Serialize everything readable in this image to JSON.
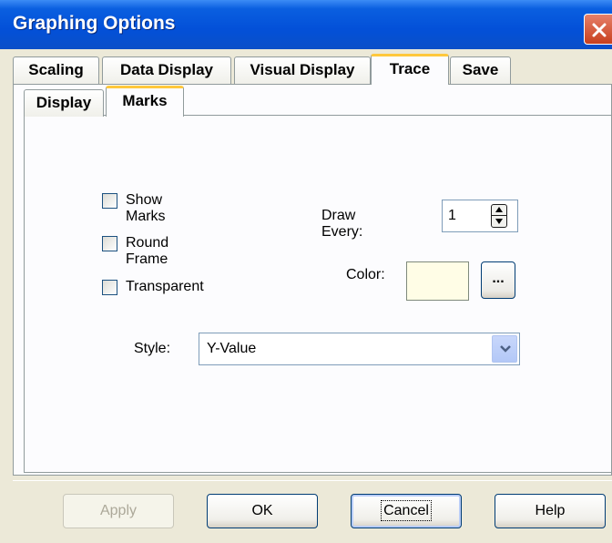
{
  "window": {
    "title": "Graphing Options"
  },
  "tabs": [
    {
      "label": "Scaling",
      "active": false
    },
    {
      "label": "Data Display",
      "active": false
    },
    {
      "label": "Visual Display",
      "active": false
    },
    {
      "label": "Trace",
      "active": true
    },
    {
      "label": "Save",
      "active": false
    }
  ],
  "subtabs": [
    {
      "label": "Display",
      "active": false
    },
    {
      "label": "Marks",
      "active": true
    }
  ],
  "marks": {
    "show_marks": {
      "label": "Show Marks",
      "checked": false
    },
    "round_frame": {
      "label": "Round Frame",
      "checked": false
    },
    "transparent": {
      "label": "Transparent",
      "checked": false
    },
    "draw_every": {
      "label": "Draw Every:",
      "value": "1"
    },
    "color": {
      "label": "Color:",
      "value": "#fffde6",
      "button_label": "..."
    },
    "style": {
      "label": "Style:",
      "value": "Y-Value"
    }
  },
  "buttons": {
    "apply": "Apply",
    "ok": "OK",
    "cancel": "Cancel",
    "help": "Help"
  }
}
